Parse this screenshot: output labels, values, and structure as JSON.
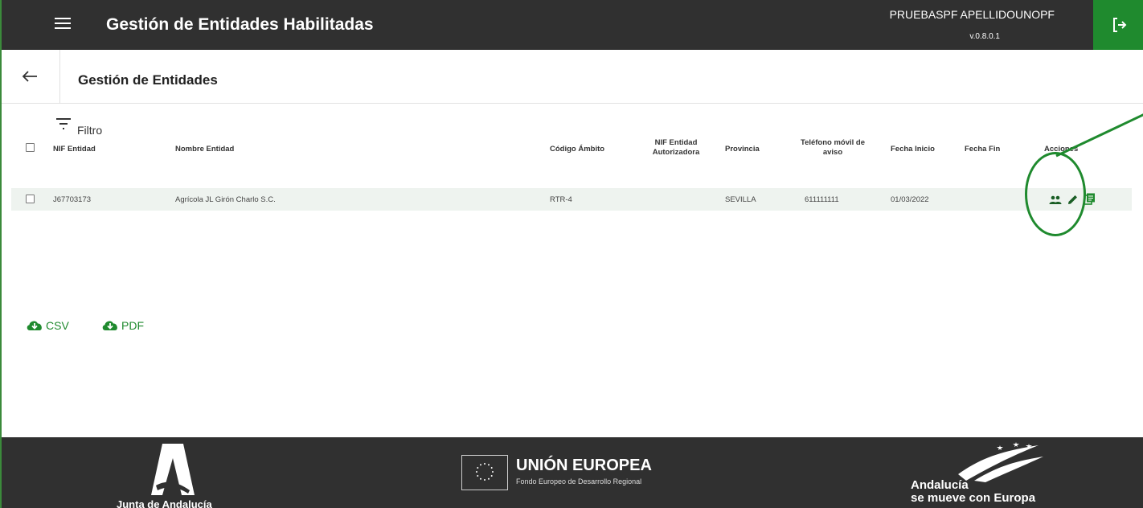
{
  "header": {
    "title": "Gestión de Entidades Habilitadas",
    "user_name": "PRUEBASPF APELLIDOUNOPF",
    "version": "v.0.8.0.1"
  },
  "subheader": {
    "title": "Gestión de Entidades"
  },
  "filter": {
    "label": "Filtro"
  },
  "table": {
    "columns": [
      "NIF Entidad",
      "Nombre Entidad",
      "Código Ámbito",
      "NIF Entidad Autorizadora",
      "Provincia",
      "Teléfono móvil de aviso",
      "Fecha Inicio",
      "Fecha Fin",
      "Acciones"
    ],
    "rows": [
      {
        "nif": "J67703173",
        "nombre": "Agrícola JL Girón Charlo S.C.",
        "codigo_ambito": "RTR-4",
        "nif_autorizadora": "",
        "provincia": "SEVILLA",
        "telefono": "611111111",
        "fecha_inicio": "01/03/2022",
        "fecha_fin": ""
      }
    ],
    "action_icons": [
      "users-icon",
      "pencil-icon",
      "document-copy-icon"
    ]
  },
  "export": {
    "csv_label": "CSV",
    "pdf_label": "PDF"
  },
  "footer": {
    "junta": "Junta de Andalucía",
    "eu_title": "UNIÓN EUROPEA",
    "eu_subtitle": "Fondo Europeo de Desarrollo Regional",
    "andalucia_line1": "Andalucía",
    "andalucia_line2": "se mueve con Europa"
  },
  "colors": {
    "topbar": "#303030",
    "accent_green": "#1f8a2e",
    "row_bg": "#eef3ef",
    "footer": "#303030"
  }
}
